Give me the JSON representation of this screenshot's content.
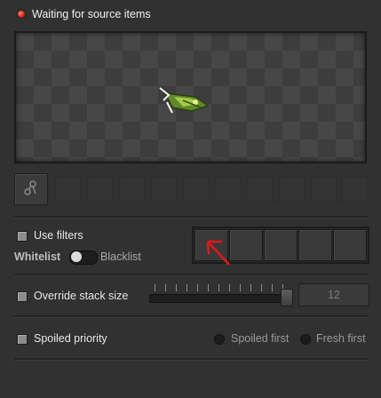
{
  "status": {
    "text": "Waiting for source items",
    "color": "#e3241b"
  },
  "preview": {
    "entity_icon": "locomotive-icon"
  },
  "selector": {
    "icon": "circuit-network-icon"
  },
  "filters": {
    "use_label": "Use filters",
    "whitelist_label": "Whitelist",
    "blacklist_label": "Blacklist",
    "mode": "Whitelist"
  },
  "stack": {
    "label": "Override stack size",
    "value": "12"
  },
  "spoil": {
    "label": "Spoiled priority",
    "option_first": "Spoiled first",
    "option_fresh": "Fresh first"
  },
  "annotation": {
    "arrow_color": "#e01818"
  }
}
